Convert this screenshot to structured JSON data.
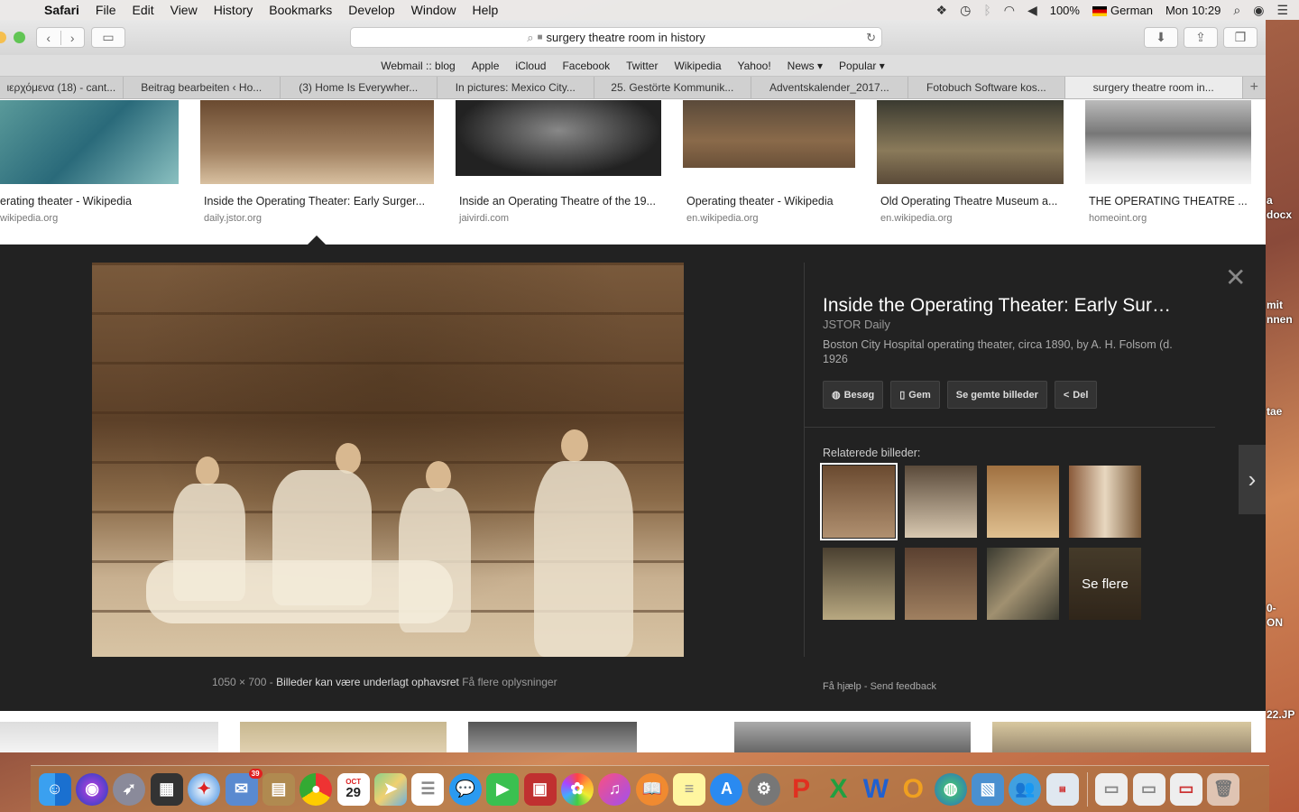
{
  "menubar": {
    "items": [
      "Safari",
      "File",
      "Edit",
      "View",
      "History",
      "Bookmarks",
      "Develop",
      "Window",
      "Help"
    ],
    "battery": "100%",
    "language": "German",
    "clock": "Mon 10:29"
  },
  "toolbar": {
    "url": "surgery theatre room in history"
  },
  "bookmarks": [
    "Webmail :: blog",
    "Apple",
    "iCloud",
    "Facebook",
    "Twitter",
    "Wikipedia",
    "Yahoo!",
    "News ▾",
    "Popular ▾"
  ],
  "tabs": [
    "ιερχόμενα (18) - cant...",
    "Beitrag bearbeiten ‹ Ho...",
    "(3) Home Is Everywher...",
    "In pictures: Mexico City...",
    "25. Gestörte Kommunik...",
    "Adventskalender_2017...",
    "Fotobuch Software kos...",
    "surgery theatre room in..."
  ],
  "results": [
    {
      "title": "erating theater - Wikipedia",
      "source": "wikipedia.org"
    },
    {
      "title": "Inside the Operating Theater: Early Surger...",
      "source": "daily.jstor.org"
    },
    {
      "title": "Inside an Operating Theatre of the 19...",
      "source": "jaivirdi.com"
    },
    {
      "title": "Operating theater - Wikipedia",
      "source": "en.wikipedia.org"
    },
    {
      "title": "Old Operating Theatre Museum a...",
      "source": "en.wikipedia.org"
    },
    {
      "title": "THE OPERATING THEATRE ...",
      "source": "homeoint.org"
    }
  ],
  "panel": {
    "title": "Inside the Operating Theater: Early Sur…",
    "source": "JSTOR Daily",
    "description": "Boston City Hospital operating theater, circa 1890, by A. H. Folsom (d. 1926",
    "buttons": {
      "visit": "Besøg",
      "save": "Gem",
      "saved": "Se gemte billeder",
      "share": "Del"
    },
    "related_label": "Relaterede billeder:",
    "more_label": "Se flere",
    "dimensions": "1050 × 700",
    "copyright": "Billeder kan være underlagt ophavsret",
    "more_info": "Få flere oplysninger",
    "help": "Få hjælp",
    "feedback": "Send feedback"
  },
  "desktop_labels": [
    "a",
    "docx",
    "mit",
    "nnen",
    "tae",
    "0-",
    "ON",
    "22.JP"
  ],
  "dock": {
    "mail_badge": "39",
    "calendar_month": "OCT",
    "calendar_day": "29"
  }
}
